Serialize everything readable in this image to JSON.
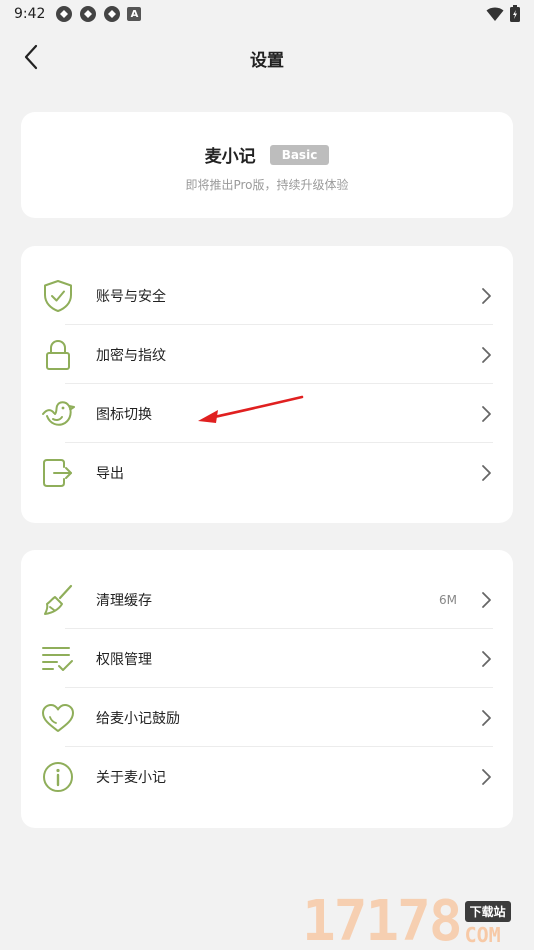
{
  "status_bar": {
    "time": "9:42",
    "notification_letter": "A"
  },
  "nav": {
    "title": "设置"
  },
  "app_card": {
    "name": "麦小记",
    "badge": "Basic",
    "subtitle": "即将推出Pro版，持续升级体验"
  },
  "section1": {
    "items": [
      {
        "label": "账号与安全",
        "icon": "shield-check-icon"
      },
      {
        "label": "加密与指纹",
        "icon": "lock-icon"
      },
      {
        "label": "图标切换",
        "icon": "bird-icon"
      },
      {
        "label": "导出",
        "icon": "export-icon"
      }
    ]
  },
  "section2": {
    "items": [
      {
        "label": "清理缓存",
        "value": "6M",
        "icon": "broom-icon"
      },
      {
        "label": "权限管理",
        "icon": "list-check-icon"
      },
      {
        "label": "给麦小记鼓励",
        "icon": "heart-icon"
      },
      {
        "label": "关于麦小记",
        "icon": "info-icon"
      }
    ]
  },
  "colors": {
    "accent_icon": "#8fae5a",
    "background": "#f2f2f2",
    "card": "#ffffff",
    "badge": "#bdbdbd",
    "annotation_arrow": "#e02020"
  },
  "watermark": {
    "digits": "17178",
    "badge": "下载站",
    "suffix": "COM"
  }
}
